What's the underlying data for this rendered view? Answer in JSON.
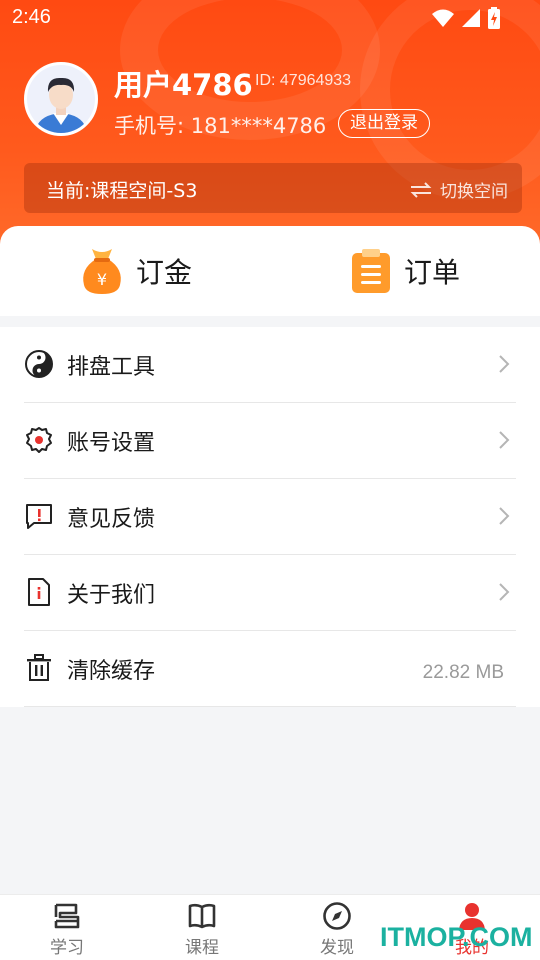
{
  "status_bar": {
    "time": "2:46"
  },
  "profile": {
    "username": "用户4786",
    "user_id": "ID: 47964933",
    "phone": "手机号: 181****4786",
    "logout_label": "退出登录"
  },
  "space": {
    "current": "当前:课程空间-S3",
    "switch_label": "切换空间"
  },
  "quick_actions": [
    {
      "label": "订金",
      "icon": "money-bag-icon"
    },
    {
      "label": "订单",
      "icon": "clipboard-icon"
    }
  ],
  "menu": [
    {
      "label": "排盘工具",
      "icon": "yin-yang-icon"
    },
    {
      "label": "账号设置",
      "icon": "gear-icon"
    },
    {
      "label": "意见反馈",
      "icon": "feedback-icon"
    },
    {
      "label": "关于我们",
      "icon": "info-document-icon"
    },
    {
      "label": "清除缓存",
      "icon": "trash-icon",
      "value": "22.82 MB"
    }
  ],
  "tabbar": [
    {
      "label": "学习",
      "icon": "study-icon"
    },
    {
      "label": "课程",
      "icon": "book-icon"
    },
    {
      "label": "发现",
      "icon": "compass-icon"
    },
    {
      "label": "我的",
      "icon": "user-icon",
      "active": true
    }
  ],
  "watermark": "ITMOP.COM",
  "colors": {
    "header": "#ff4a12",
    "accent": "#e8322e",
    "icon_orange": "#ff8a1e",
    "watermark": "#1bb1a0"
  }
}
